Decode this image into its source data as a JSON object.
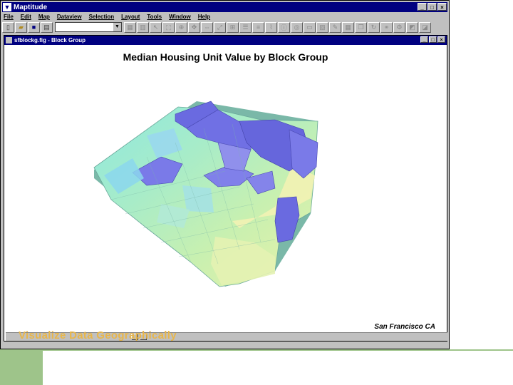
{
  "app": {
    "title": "Maptitude",
    "window_buttons": [
      "_",
      "□",
      "×"
    ]
  },
  "menu": [
    "File",
    "Edit",
    "Map",
    "Dataview",
    "Selection",
    "Layout",
    "Tools",
    "Window",
    "Help"
  ],
  "toolbar": {
    "layer_combo_value": ""
  },
  "document": {
    "title": "sfblockg.fig - Block Group",
    "map_title": "Median Housing Unit Value by Block Group",
    "caption": "San Francisco CA"
  },
  "overlay_text": "Visualize Data Geographically",
  "colors": {
    "titlebar": "#000080",
    "low_value": "#f0f0b0",
    "mid_value": "#a8e8c8",
    "high_value": "#6060d8",
    "overlay_text": "#e8b64a"
  }
}
